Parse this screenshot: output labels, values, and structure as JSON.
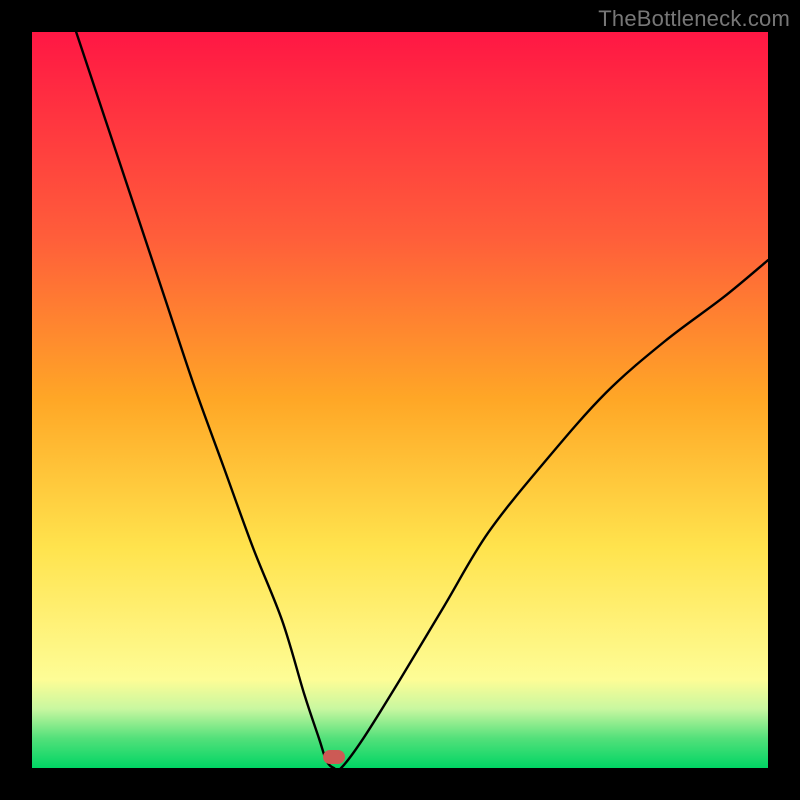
{
  "watermark": "TheBottleneck.com",
  "chart_data": {
    "type": "line",
    "title": "",
    "xlabel": "",
    "ylabel": "",
    "xlim": [
      0,
      100
    ],
    "ylim": [
      0,
      100
    ],
    "gradient_stops": [
      {
        "pct": 0,
        "color": "#ff1744"
      },
      {
        "pct": 28,
        "color": "#ff5e3a"
      },
      {
        "pct": 50,
        "color": "#ffa726"
      },
      {
        "pct": 70,
        "color": "#ffe34d"
      },
      {
        "pct": 80,
        "color": "#fff176"
      },
      {
        "pct": 88,
        "color": "#fdfd96"
      },
      {
        "pct": 92,
        "color": "#c8f7a0"
      },
      {
        "pct": 96,
        "color": "#52e07a"
      },
      {
        "pct": 100,
        "color": "#00d564"
      }
    ],
    "series": [
      {
        "name": "bottleneck-curve",
        "x": [
          6,
          10,
          14,
          18,
          22,
          26,
          30,
          34,
          37,
          39,
          40,
          41,
          42,
          45,
          50,
          56,
          62,
          70,
          78,
          86,
          94,
          100
        ],
        "y": [
          100,
          88,
          76,
          64,
          52,
          41,
          30,
          20,
          10,
          4,
          1,
          0,
          0,
          4,
          12,
          22,
          32,
          42,
          51,
          58,
          64,
          69
        ]
      }
    ],
    "marker": {
      "x": 41,
      "y": 1.5,
      "color": "#cc5a55"
    }
  }
}
